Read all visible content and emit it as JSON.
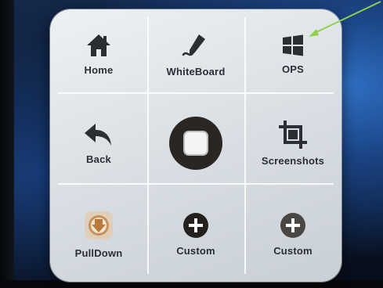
{
  "menu": {
    "items": [
      {
        "id": "home",
        "label": "Home",
        "icon": "home-icon"
      },
      {
        "id": "whiteboard",
        "label": "WhiteBoard",
        "icon": "pen-icon"
      },
      {
        "id": "ops",
        "label": "OPS",
        "icon": "windows-icon"
      },
      {
        "id": "back",
        "label": "Back",
        "icon": "back-arrow-icon"
      },
      {
        "id": "center",
        "label": "",
        "icon": "home-button-icon"
      },
      {
        "id": "screenshots",
        "label": "Screenshots",
        "icon": "crop-icon"
      },
      {
        "id": "pulldown",
        "label": "PullDown",
        "icon": "pulldown-icon"
      },
      {
        "id": "custom1",
        "label": "Custom",
        "icon": "plus-icon"
      },
      {
        "id": "custom2",
        "label": "Custom",
        "icon": "plus-icon"
      }
    ]
  },
  "annotation": {
    "color": "#8fd14f",
    "icon": "arrow-annotation"
  }
}
